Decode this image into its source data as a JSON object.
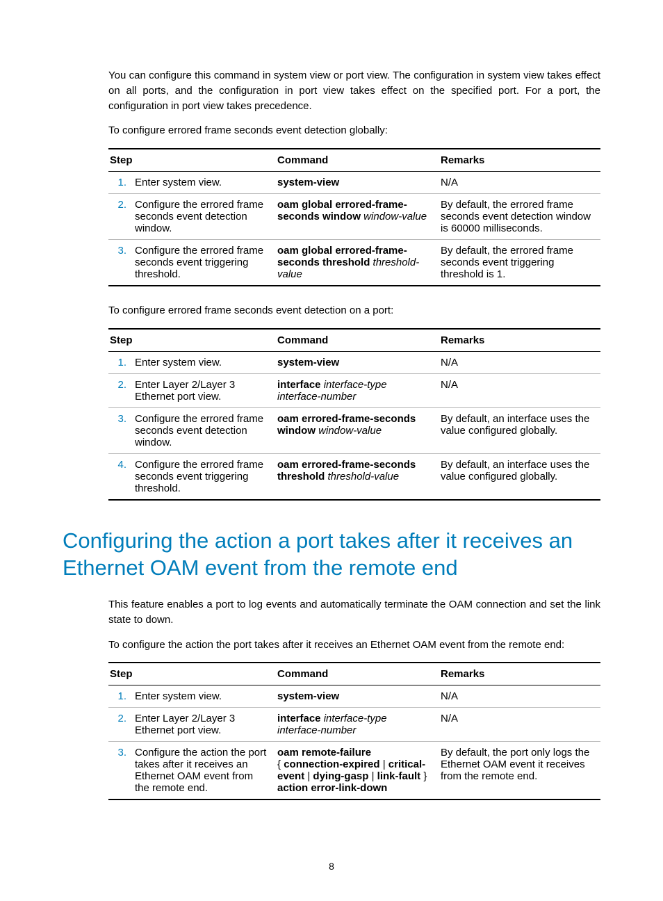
{
  "para1": "You can configure this command in system view or port view. The configuration in system view takes effect on all ports, and the configuration in port view takes effect on the specified port. For a port, the configuration in port view takes precedence.",
  "para2": "To configure errored frame seconds event detection globally:",
  "para3": "To configure errored frame seconds event detection on a port:",
  "heading": "Configuring the action a port takes after it receives an Ethernet OAM event from the remote end",
  "para4": "This feature enables a port to log events and automatically terminate the OAM connection and set the link state to down.",
  "para5": "To configure the action the port takes after it receives an Ethernet OAM event from the remote end:",
  "headers": {
    "step": "Step",
    "command": "Command",
    "remarks": "Remarks"
  },
  "t1": {
    "r1": {
      "n": "1.",
      "step": "Enter system view.",
      "cmd_b": "system-view",
      "rem": "N/A"
    },
    "r2": {
      "n": "2.",
      "step": "Configure the errored frame seconds event detection window.",
      "cmd_b1": "oam global errored-frame-seconds window",
      "cmd_i1": " window-value",
      "rem": "By default, the errored frame seconds event detection window is 60000 milliseconds."
    },
    "r3": {
      "n": "3.",
      "step": "Configure the errored frame seconds event triggering threshold.",
      "cmd_b1": "oam global errored-frame-seconds threshold",
      "cmd_i1": " threshold-value",
      "rem": "By default, the errored frame seconds event triggering threshold is 1."
    }
  },
  "t2": {
    "r1": {
      "n": "1.",
      "step": "Enter system view.",
      "cmd_b": "system-view",
      "rem": "N/A"
    },
    "r2": {
      "n": "2.",
      "step": "Enter Layer 2/Layer 3 Ethernet port view.",
      "cmd_b1": "interface",
      "cmd_i1": " interface-type interface-number",
      "rem": "N/A"
    },
    "r3": {
      "n": "3.",
      "step": "Configure the errored frame seconds event detection window.",
      "cmd_b1": "oam errored-frame-seconds window",
      "cmd_i1": " window-value",
      "rem": "By default, an interface uses the value configured globally."
    },
    "r4": {
      "n": "4.",
      "step": "Configure the errored frame seconds event triggering threshold.",
      "cmd_b1": "oam errored-frame-seconds threshold",
      "cmd_i1": " threshold-value",
      "rem": "By default, an interface uses the value configured globally."
    }
  },
  "t3": {
    "r1": {
      "n": "1.",
      "step": "Enter system view.",
      "cmd_b": "system-view",
      "rem": "N/A"
    },
    "r2": {
      "n": "2.",
      "step": "Enter Layer 2/Layer 3 Ethernet port view.",
      "cmd_b1": "interface",
      "cmd_i1": " interface-type interface-number",
      "rem": "N/A"
    },
    "r3": {
      "n": "3.",
      "step": "Configure the action the port takes after it receives an Ethernet OAM event from the remote end.",
      "cmd_b1": "oam remote-failure",
      "cmd_plain_open": " { ",
      "cmd_b2": "connection-expired",
      "cmd_sep1": " | ",
      "cmd_b3": "critical-event",
      "cmd_sep2": " | ",
      "cmd_b4": "dying-gasp",
      "cmd_sep3": " | ",
      "cmd_b5": "link-fault",
      "cmd_plain_close": " } ",
      "cmd_b6": "action error-link-down",
      "rem": "By default, the port only logs the Ethernet OAM event it receives from the remote end."
    }
  },
  "pagenum": "8"
}
